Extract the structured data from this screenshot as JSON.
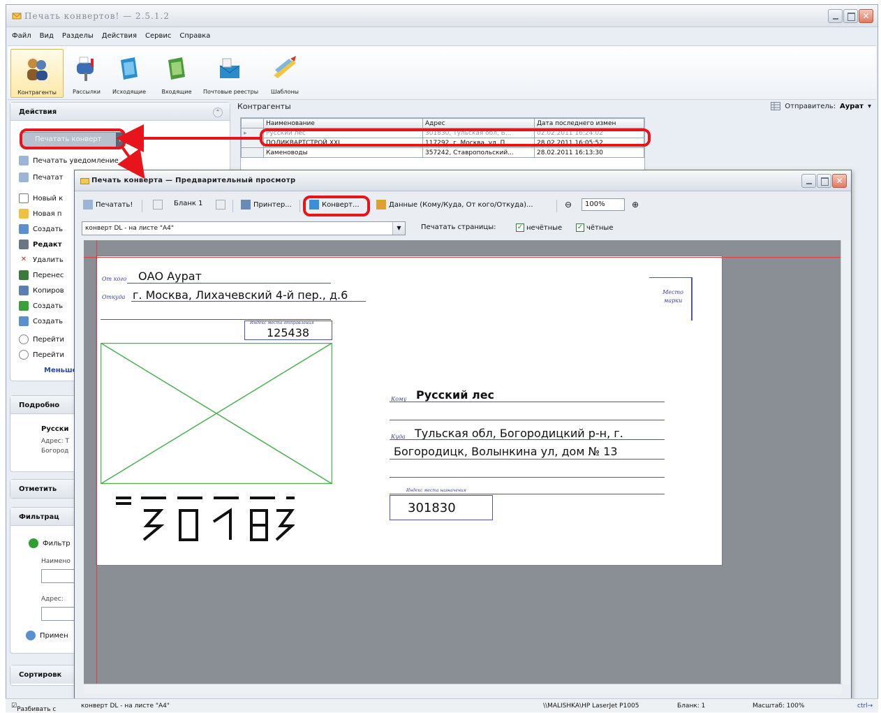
{
  "window": {
    "title": "Печать конвертов! — 2.5.1.2"
  },
  "menu": [
    "Файл",
    "Вид",
    "Разделы",
    "Действия",
    "Сервис",
    "Справка"
  ],
  "ribbon": [
    "Контрагенты",
    "Рассылки",
    "Исходящие",
    "Входящие",
    "Почтовые реестры",
    "Шаблоны"
  ],
  "left": {
    "actions_title": "Действия",
    "print_button": "Печатать конверт",
    "print_notice": "Печатать уведомление",
    "print_partial": "Печатат",
    "actions": [
      "Новый к",
      "Новая п",
      "Создать",
      "Редакт",
      "Удалить",
      "Перенес",
      "Копиров",
      "Создать",
      "Создать",
      "Перейти",
      "Перейти"
    ],
    "more_link": "Меньше",
    "details_title": "Подробно",
    "details_name": "Русски",
    "details_addr1": "Адрес: Т",
    "details_addr2": "Богород",
    "mark_title": "Отметить",
    "filter_title": "Фильтрац",
    "filter_label": "Фильтр",
    "filter_name_label": "Наимено",
    "filter_addr_label": "Адрес:",
    "apply_label": "Примен",
    "sort_title": "Сортировк",
    "group_check_label": "Разбивать с"
  },
  "contragents": {
    "label": "Контрагенты",
    "sender_label": "Отправитель:",
    "sender_value": "Аурат",
    "columns": [
      "Наименование",
      "Адрес",
      "Дата последнего измен"
    ],
    "rows": [
      [
        "Русский лес",
        "301830, Тульская обл, Б...",
        "02.02.2011 16:24:02"
      ],
      [
        "ПОЛИКВАРТСТРОЙ XXI",
        "117292, г. Москва, ул. П...",
        "28.02.2011 16:05:52"
      ],
      [
        "Каменоводы",
        "357242, Ставропольский...",
        "28.02.2011 16:13:30"
      ]
    ]
  },
  "preview": {
    "title": "Печать конверта — Предварительный просмотр",
    "toolbar": {
      "print": "Печатать!",
      "blank": "Бланк 1",
      "printer": "Принтер...",
      "envelope": "Конверт...",
      "data": "Данные (Кому/Куда, От кого/Откуда)...",
      "zoom": "100%"
    },
    "template": "конверт DL - на листе \"A4\"",
    "print_pages_label": "Печатать страницы:",
    "odd_label": "нечётные",
    "even_label": "чётные"
  },
  "envelope": {
    "from_label": "От кого",
    "from_value": "ОАО Аурат",
    "from_addr_label": "Откуда",
    "from_addr_value": "г. Москва, Лихачевский 4-й пер., д.6",
    "stamp_label": "Место марки",
    "sender_index_label": "Индекс места отправления",
    "sender_index": "125438",
    "to_label": "Кому",
    "to_value": "Русский лес",
    "to_addr_label": "Куда",
    "to_addr_line1": "Тульская обл, Богородицкий р-н, г.",
    "to_addr_line2": "Богородицк, Волынкина ул, дом № 13",
    "recipient_index_label": "Индекс места назначения",
    "recipient_index": "301830"
  },
  "status": {
    "template": "конверт DL - на листе \"A4\"",
    "printer": "\\\\MALISHKA\\HP LaserJet P1005",
    "blank": "Бланк: 1",
    "scale": "Масштаб: 100%",
    "extra": "ctrl→"
  },
  "colors": {
    "annotation": "#e8141b",
    "envelope_ink": "#4b52b8",
    "photo_frame": "#4caf50"
  }
}
